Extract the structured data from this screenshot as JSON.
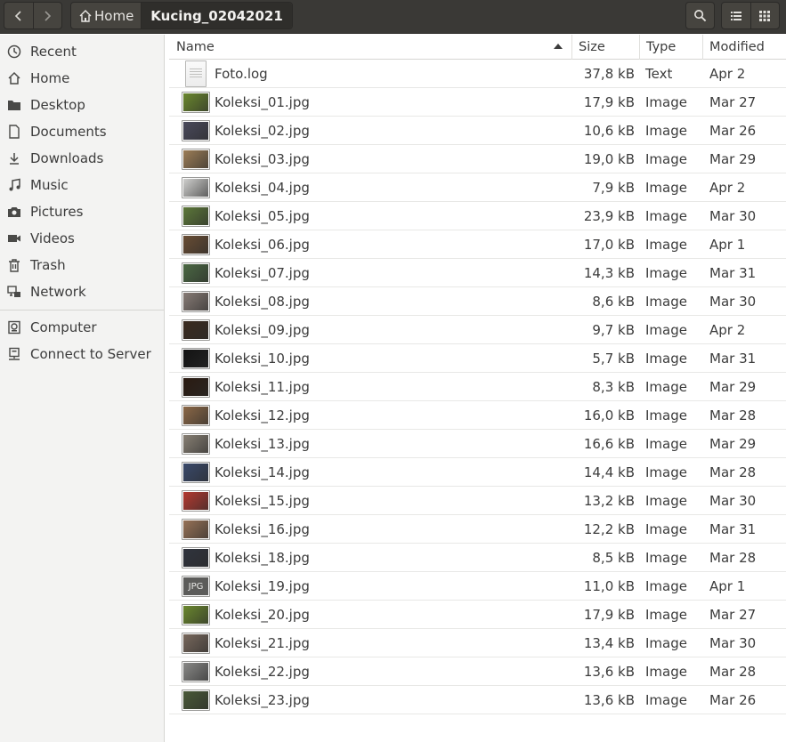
{
  "header": {
    "back_icon": "chevron-left-icon",
    "forward_icon": "chevron-right-icon",
    "breadcrumb": [
      {
        "label": "Home",
        "icon": "home-icon"
      },
      {
        "label": "Kucing_02042021"
      }
    ],
    "search_icon": "search-icon",
    "list_view_icon": "list-view-icon",
    "grid_view_icon": "grid-view-icon"
  },
  "sidebar": {
    "items": [
      {
        "label": "Recent",
        "icon": "clock-icon"
      },
      {
        "label": "Home",
        "icon": "home-icon"
      },
      {
        "label": "Desktop",
        "icon": "folder-icon"
      },
      {
        "label": "Documents",
        "icon": "document-icon"
      },
      {
        "label": "Downloads",
        "icon": "download-icon"
      },
      {
        "label": "Music",
        "icon": "music-icon"
      },
      {
        "label": "Pictures",
        "icon": "camera-icon"
      },
      {
        "label": "Videos",
        "icon": "video-icon"
      },
      {
        "label": "Trash",
        "icon": "trash-icon"
      },
      {
        "label": "Network",
        "icon": "network-icon"
      },
      {
        "label": "Computer",
        "icon": "computer-icon"
      },
      {
        "label": "Connect to Server",
        "icon": "server-icon"
      }
    ]
  },
  "list": {
    "columns": {
      "name": "Name",
      "size": "Size",
      "type": "Type",
      "modified": "Modified"
    },
    "sorted_by": "Name",
    "sort_direction": "ascending",
    "files": [
      {
        "name": "Foto.log",
        "size": "37,8 kB",
        "type": "Text",
        "modified": "Apr 2",
        "thumb": "document",
        "color": ""
      },
      {
        "name": "Koleksi_01.jpg",
        "size": "17,9 kB",
        "type": "Image",
        "modified": "Mar 27",
        "thumb": "photo",
        "color": "#6c8a2e"
      },
      {
        "name": "Koleksi_02.jpg",
        "size": "10,6 kB",
        "type": "Image",
        "modified": "Mar 26",
        "thumb": "photo",
        "color": "#4a4a5c"
      },
      {
        "name": "Koleksi_03.jpg",
        "size": "19,0 kB",
        "type": "Image",
        "modified": "Mar 29",
        "thumb": "photo",
        "color": "#a08058"
      },
      {
        "name": "Koleksi_04.jpg",
        "size": "7,9 kB",
        "type": "Image",
        "modified": "Apr 2",
        "thumb": "photo",
        "color": "#d4d4d2"
      },
      {
        "name": "Koleksi_05.jpg",
        "size": "23,9 kB",
        "type": "Image",
        "modified": "Mar 30",
        "thumb": "photo",
        "color": "#5e7a3a"
      },
      {
        "name": "Koleksi_06.jpg",
        "size": "17,0 kB",
        "type": "Image",
        "modified": "Apr 1",
        "thumb": "photo",
        "color": "#6a4e34"
      },
      {
        "name": "Koleksi_07.jpg",
        "size": "14,3 kB",
        "type": "Image",
        "modified": "Mar 31",
        "thumb": "photo",
        "color": "#4c6a44"
      },
      {
        "name": "Koleksi_08.jpg",
        "size": "8,6 kB",
        "type": "Image",
        "modified": "Mar 30",
        "thumb": "photo",
        "color": "#8a7e78"
      },
      {
        "name": "Koleksi_09.jpg",
        "size": "9,7 kB",
        "type": "Image",
        "modified": "Apr 2",
        "thumb": "photo",
        "color": "#3a2a1e"
      },
      {
        "name": "Koleksi_10.jpg",
        "size": "5,7 kB",
        "type": "Image",
        "modified": "Mar 31",
        "thumb": "photo",
        "color": "#121212"
      },
      {
        "name": "Koleksi_11.jpg",
        "size": "8,3 kB",
        "type": "Image",
        "modified": "Mar 29",
        "thumb": "photo",
        "color": "#2a1a10"
      },
      {
        "name": "Koleksi_12.jpg",
        "size": "16,0 kB",
        "type": "Image",
        "modified": "Mar 28",
        "thumb": "photo",
        "color": "#8e6a48"
      },
      {
        "name": "Koleksi_13.jpg",
        "size": "16,6 kB",
        "type": "Image",
        "modified": "Mar 29",
        "thumb": "photo",
        "color": "#8a8276"
      },
      {
        "name": "Koleksi_14.jpg",
        "size": "14,4 kB",
        "type": "Image",
        "modified": "Mar 28",
        "thumb": "photo",
        "color": "#3a4a6c"
      },
      {
        "name": "Koleksi_15.jpg",
        "size": "13,2 kB",
        "type": "Image",
        "modified": "Mar 30",
        "thumb": "photo",
        "color": "#b83a30"
      },
      {
        "name": "Koleksi_16.jpg",
        "size": "12,2 kB",
        "type": "Image",
        "modified": "Mar 31",
        "thumb": "photo",
        "color": "#9a7458"
      },
      {
        "name": "Koleksi_18.jpg",
        "size": "8,5 kB",
        "type": "Image",
        "modified": "Mar 28",
        "thumb": "photo",
        "color": "#30343e"
      },
      {
        "name": "Koleksi_19.jpg",
        "size": "11,0 kB",
        "type": "Image",
        "modified": "Apr 1",
        "thumb": "generic",
        "color": "#5c5c5a",
        "thumb_label": "JPG"
      },
      {
        "name": "Koleksi_20.jpg",
        "size": "17,9 kB",
        "type": "Image",
        "modified": "Mar 27",
        "thumb": "photo",
        "color": "#6c8a2e"
      },
      {
        "name": "Koleksi_21.jpg",
        "size": "13,4 kB",
        "type": "Image",
        "modified": "Mar 30",
        "thumb": "photo",
        "color": "#7a6a5e"
      },
      {
        "name": "Koleksi_22.jpg",
        "size": "13,6 kB",
        "type": "Image",
        "modified": "Mar 28",
        "thumb": "photo",
        "color": "#8c8c8a"
      },
      {
        "name": "Koleksi_23.jpg",
        "size": "13,6 kB",
        "type": "Image",
        "modified": "Mar 26",
        "thumb": "photo",
        "color": "#4a5a38"
      }
    ]
  }
}
